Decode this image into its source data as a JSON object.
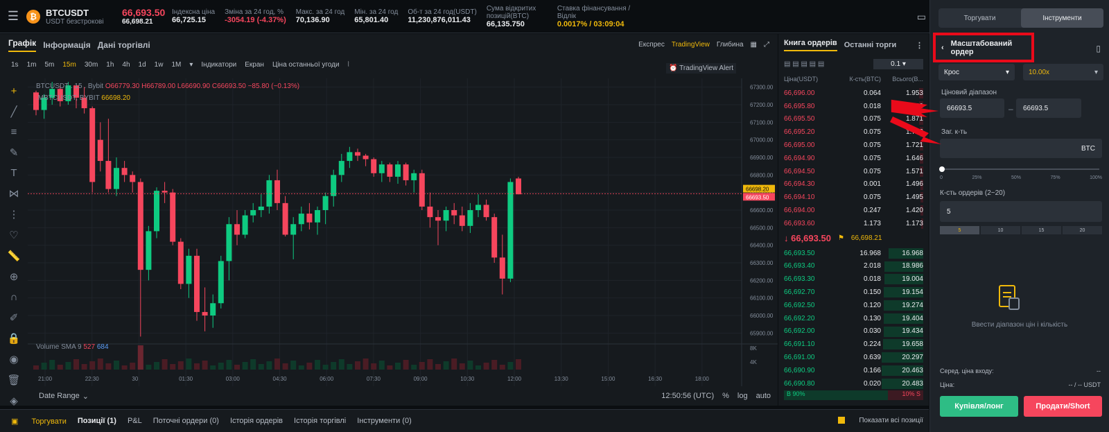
{
  "header": {
    "symbol": "BTCUSDT",
    "subtitle": "USDT безстрокові",
    "last_price": "66,693.50",
    "mark_price": "66,698.21",
    "stats": [
      {
        "label": "Індексна ціна",
        "value": "66,725.15"
      },
      {
        "label": "Зміна за 24 год, %",
        "value": "-3054.19 (-4.37%)"
      },
      {
        "label": "Макс. за 24 год",
        "value": "70,136.90"
      },
      {
        "label": "Мін. за 24 год",
        "value": "65,801.40"
      },
      {
        "label": "Об-т за 24 год(USDT)",
        "value": "11,230,876,011.43"
      },
      {
        "label": "Сума відкритих позицій(BTC)",
        "value": "66,135.750"
      },
      {
        "label": "Ставка фінансування / Відлік",
        "value": "0.0017% / 03:09:04"
      }
    ]
  },
  "chart_panel": {
    "tabs": [
      "Графік",
      "Інформація",
      "Дані торгівлі"
    ],
    "view_modes": [
      "Експрес",
      "TradingView",
      "Глибина"
    ],
    "intervals": [
      "1s",
      "1m",
      "5m",
      "15m",
      "30m",
      "1h",
      "4h",
      "1d",
      "1w",
      "1M"
    ],
    "active_interval": "15m",
    "tools": [
      "Індикатори",
      "Екран",
      "Ціна останньої угоди"
    ],
    "tv_alert": "TradingView Alert",
    "ohlc_line": "BTCUSDT . 15 . Bybit",
    "ohlc_values": "O66779.30 H66789.00 L66690.90 C66693.50 −85.80 (−0.13%)",
    "mark_line": ".MBTCUSDT, BYBIT",
    "mark_value": "66698.20",
    "volume_label": "Volume SMA 9",
    "volume_v1": "527",
    "volume_v2": "684",
    "date_range": "Date Range",
    "clock": "12:50:56 (UTC)",
    "scale_opts": [
      "%",
      "log",
      "auto"
    ],
    "price_tag_mark": "66698.20",
    "price_tag_last": "66693.50"
  },
  "chart_data": {
    "type": "candlestick",
    "y_ticks": [
      "67300.00",
      "67200.00",
      "67100.00",
      "67000.00",
      "66900.00",
      "66800.00",
      "66700.00",
      "66600.00",
      "66500.00",
      "66400.00",
      "66300.00",
      "66200.00",
      "66100.00",
      "66000.00",
      "65900.00"
    ],
    "x_ticks": [
      "21:00",
      "22:30",
      "30",
      "01:30",
      "03:00",
      "04:30",
      "06:00",
      "07:30",
      "09:00",
      "10:30",
      "12:00",
      "13:30",
      "15:00",
      "16:30",
      "18:00"
    ],
    "vol_ticks": [
      "8K",
      "4K"
    ],
    "candles": [
      [
        67270,
        67280,
        67140,
        67170
      ],
      [
        67170,
        67260,
        67120,
        67240
      ],
      [
        67240,
        67330,
        67200,
        67290
      ],
      [
        67290,
        67310,
        67190,
        67220
      ],
      [
        67220,
        67330,
        67200,
        67310
      ],
      [
        67310,
        67290,
        67180,
        67240
      ],
      [
        67240,
        67300,
        67150,
        67180
      ],
      [
        67180,
        67190,
        66700,
        66760
      ],
      [
        67000,
        67100,
        66820,
        66880
      ],
      [
        66880,
        67120,
        66700,
        66720
      ],
      [
        66720,
        66900,
        66680,
        66840
      ],
      [
        66840,
        66880,
        66760,
        66800
      ],
      [
        66800,
        66820,
        66700,
        66760
      ],
      [
        66760,
        66780,
        65880,
        66260
      ],
      [
        66260,
        66510,
        66200,
        66480
      ],
      [
        66480,
        66730,
        66440,
        66710
      ],
      [
        66710,
        66760,
        66640,
        66700
      ],
      [
        66700,
        66720,
        66400,
        66420
      ],
      [
        66420,
        66440,
        66150,
        66180
      ],
      [
        66180,
        66380,
        66100,
        66340
      ],
      [
        66340,
        66380,
        65970,
        66020
      ],
      [
        66020,
        66160,
        65910,
        66000
      ],
      [
        66000,
        66120,
        65930,
        66070
      ],
      [
        66070,
        66340,
        66040,
        66310
      ],
      [
        66310,
        66560,
        66200,
        66520
      ],
      [
        66520,
        66600,
        66400,
        66460
      ],
      [
        66460,
        66600,
        66440,
        66570
      ],
      [
        66570,
        66640,
        66530,
        66600
      ],
      [
        66600,
        66690,
        66560,
        66620
      ],
      [
        66620,
        66800,
        66580,
        66770
      ],
      [
        66770,
        66830,
        66600,
        66640
      ],
      [
        66640,
        66680,
        66450,
        66460
      ],
      [
        66460,
        66560,
        66320,
        66520
      ],
      [
        66520,
        66620,
        66480,
        66580
      ],
      [
        66580,
        66640,
        66490,
        66530
      ],
      [
        66530,
        66620,
        66460,
        66600
      ],
      [
        66600,
        66700,
        66520,
        66680
      ],
      [
        66680,
        66830,
        66620,
        66800
      ],
      [
        66800,
        66920,
        66760,
        66880
      ],
      [
        66880,
        66960,
        66840,
        66930
      ],
      [
        66930,
        66950,
        66880,
        66910
      ],
      [
        66910,
        66920,
        66850,
        66890
      ],
      [
        66890,
        66900,
        66790,
        66810
      ],
      [
        66810,
        66880,
        66760,
        66860
      ],
      [
        66860,
        66870,
        66760,
        66790
      ],
      [
        66790,
        66880,
        66750,
        66860
      ],
      [
        66860,
        66870,
        66740,
        66770
      ],
      [
        66770,
        66830,
        66700,
        66810
      ],
      [
        66810,
        66830,
        66600,
        66620
      ],
      [
        66620,
        66700,
        66500,
        66560
      ],
      [
        66560,
        66600,
        66400,
        66540
      ],
      [
        66540,
        66620,
        66480,
        66600
      ],
      [
        66600,
        66640,
        66520,
        66570
      ],
      [
        66570,
        66620,
        66480,
        66510
      ],
      [
        66510,
        66640,
        66470,
        66600
      ],
      [
        66600,
        66690,
        66560,
        66630
      ],
      [
        66630,
        66660,
        66540,
        66560
      ],
      [
        66560,
        66580,
        66300,
        66330
      ],
      [
        66330,
        66460,
        66120,
        66210
      ],
      [
        66210,
        66780,
        66190,
        66760
      ],
      [
        66780,
        66790,
        66690,
        66690
      ]
    ]
  },
  "orderbook": {
    "tabs": [
      "Книга ордерів",
      "Останні торги"
    ],
    "precision": "0.1",
    "headers": [
      "Ціна(USDT)",
      "К-сть(BTC)",
      "Всього(B..."
    ],
    "asks": [
      [
        "66,696.00",
        "0.064",
        "1.953"
      ],
      [
        "66,695.80",
        "0.018",
        "1.889"
      ],
      [
        "66,695.50",
        "0.075",
        "1.871"
      ],
      [
        "66,695.20",
        "0.075",
        "1.796"
      ],
      [
        "66,695.00",
        "0.075",
        "1.721"
      ],
      [
        "66,694.90",
        "0.075",
        "1.646"
      ],
      [
        "66,694.50",
        "0.075",
        "1.571"
      ],
      [
        "66,694.30",
        "0.001",
        "1.496"
      ],
      [
        "66,694.10",
        "0.075",
        "1.495"
      ],
      [
        "66,694.00",
        "0.247",
        "1.420"
      ],
      [
        "66,693.60",
        "1.173",
        "1.173"
      ]
    ],
    "mid_price": "↓ 66,693.50",
    "mid_index": "66,698.21",
    "bids": [
      [
        "66,693.50",
        "16.968",
        "16.968"
      ],
      [
        "66,693.40",
        "2.018",
        "18.986"
      ],
      [
        "66,693.30",
        "0.018",
        "19.004"
      ],
      [
        "66,692.70",
        "0.150",
        "19.154"
      ],
      [
        "66,692.50",
        "0.120",
        "19.274"
      ],
      [
        "66,692.20",
        "0.130",
        "19.404"
      ],
      [
        "66,692.00",
        "0.030",
        "19.434"
      ],
      [
        "66,691.10",
        "0.224",
        "19.658"
      ],
      [
        "66,691.00",
        "0.639",
        "20.297"
      ],
      [
        "66,690.90",
        "0.166",
        "20.463"
      ],
      [
        "66,690.80",
        "0.020",
        "20.483"
      ]
    ],
    "buy_ratio": "90%",
    "sell_ratio": "10%"
  },
  "order_form": {
    "tabs": [
      "Торгувати",
      "Інструменти"
    ],
    "title": "Масштабований ордер",
    "margin_mode": "Крос",
    "leverage": "10.00x",
    "price_range_label": "Ціновий діапазон",
    "price_from": "66693.5",
    "price_to": "66693.5",
    "qty_label": "Заг. к-ть",
    "qty_unit": "BTC",
    "slider_ticks": [
      "0",
      "25%",
      "50%",
      "75%",
      "100%"
    ],
    "orders_label": "К-сть ордерів (2~20)",
    "orders_value": "5",
    "orders_presets": [
      "5",
      "10",
      "15",
      "20"
    ],
    "empty_text": "Ввести діапазон цін і кількість",
    "avg_label": "Серед. ціна входу:",
    "avg_value": "--",
    "price_label": "Ціна:",
    "price_value": "-- / -- USDT",
    "buy_label": "Купівля/лонг",
    "sell_label": "Продати/Short"
  },
  "bottom_tabs": [
    "Торгувати",
    "Позиції (1)",
    "P&L",
    "Поточні ордери (0)",
    "Історія ордерів",
    "Історія торгівлі",
    "Інструменти (0)"
  ],
  "show_all": "Показати всі позиції",
  "colors": {
    "up": "#0ecb81",
    "down": "#f6465d",
    "accent": "#f0b90b"
  }
}
